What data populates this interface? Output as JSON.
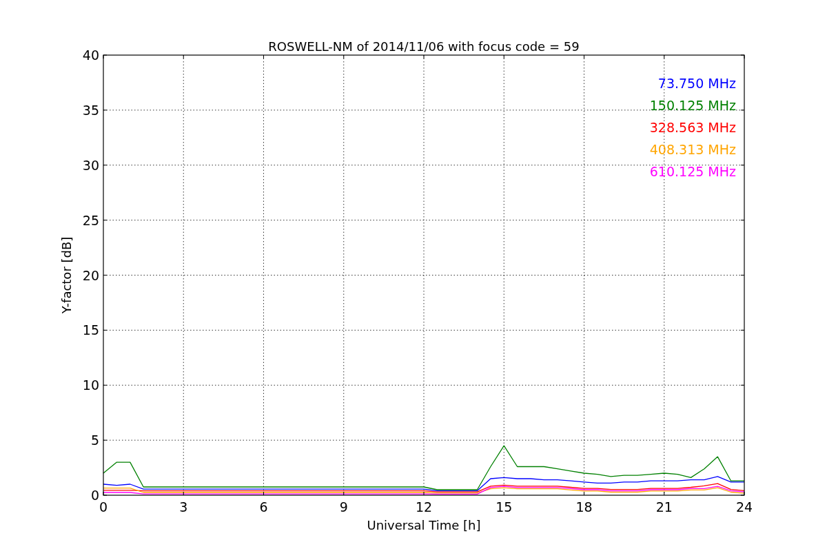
{
  "chart": {
    "chart_data": {
      "type": "line",
      "title": "ROSWELL-NM of 2014/11/06 with focus code = 59",
      "xlabel": "Universal Time [h]",
      "ylabel": "Y-factor [dB]",
      "x": [
        0,
        0.5,
        1,
        1.5,
        2,
        2.5,
        3,
        3.5,
        4,
        4.5,
        5,
        5.5,
        6,
        6.5,
        7,
        7.5,
        8,
        8.5,
        9,
        9.5,
        10,
        10.5,
        11,
        11.5,
        12,
        12.5,
        13,
        13.5,
        14,
        14.5,
        15,
        15.5,
        16,
        16.5,
        17,
        17.5,
        18,
        18.5,
        19,
        19.5,
        20,
        20.5,
        21,
        21.5,
        22,
        22.5,
        23,
        23.5,
        24
      ],
      "series": [
        {
          "name": "73.750 MHz",
          "color": "#0000ff",
          "values": [
            1.0,
            0.9,
            1.0,
            0.55,
            0.55,
            0.55,
            0.55,
            0.55,
            0.55,
            0.55,
            0.55,
            0.55,
            0.55,
            0.55,
            0.55,
            0.55,
            0.55,
            0.55,
            0.55,
            0.55,
            0.55,
            0.55,
            0.55,
            0.55,
            0.55,
            0.4,
            0.4,
            0.4,
            0.4,
            1.5,
            1.6,
            1.5,
            1.5,
            1.4,
            1.4,
            1.3,
            1.2,
            1.1,
            1.1,
            1.2,
            1.2,
            1.3,
            1.3,
            1.3,
            1.4,
            1.4,
            1.7,
            1.2,
            1.2
          ]
        },
        {
          "name": "150.125 MHz",
          "color": "#008000",
          "values": [
            2.0,
            3.0,
            3.0,
            0.75,
            0.75,
            0.75,
            0.75,
            0.75,
            0.75,
            0.75,
            0.75,
            0.75,
            0.75,
            0.75,
            0.75,
            0.75,
            0.75,
            0.75,
            0.75,
            0.75,
            0.75,
            0.75,
            0.75,
            0.75,
            0.75,
            0.5,
            0.5,
            0.5,
            0.5,
            2.6,
            4.5,
            2.6,
            2.6,
            2.6,
            2.4,
            2.2,
            2.0,
            1.9,
            1.7,
            1.8,
            1.8,
            1.9,
            2.0,
            1.9,
            1.6,
            2.4,
            3.5,
            1.3,
            1.3
          ]
        },
        {
          "name": "328.563 MHz",
          "color": "#ff0000",
          "values": [
            0.45,
            0.45,
            0.45,
            0.4,
            0.4,
            0.4,
            0.4,
            0.4,
            0.4,
            0.4,
            0.4,
            0.4,
            0.4,
            0.4,
            0.4,
            0.4,
            0.4,
            0.4,
            0.4,
            0.4,
            0.4,
            0.4,
            0.4,
            0.4,
            0.4,
            0.3,
            0.3,
            0.3,
            0.3,
            0.82,
            0.92,
            0.82,
            0.82,
            0.82,
            0.82,
            0.72,
            0.62,
            0.62,
            0.52,
            0.52,
            0.52,
            0.62,
            0.62,
            0.62,
            0.72,
            0.85,
            1.05,
            0.52,
            0.42
          ]
        },
        {
          "name": "408.313 MHz",
          "color": "#ffa500",
          "values": [
            0.65,
            0.65,
            0.65,
            0.25,
            0.25,
            0.25,
            0.25,
            0.25,
            0.25,
            0.25,
            0.25,
            0.25,
            0.25,
            0.25,
            0.25,
            0.25,
            0.25,
            0.25,
            0.25,
            0.25,
            0.25,
            0.25,
            0.25,
            0.25,
            0.25,
            0.2,
            0.2,
            0.2,
            0.2,
            0.58,
            0.68,
            0.58,
            0.58,
            0.58,
            0.58,
            0.48,
            0.38,
            0.38,
            0.28,
            0.28,
            0.28,
            0.38,
            0.38,
            0.38,
            0.48,
            0.48,
            0.68,
            0.28,
            0.18
          ]
        },
        {
          "name": "610.125 MHz",
          "color": "#ff00ff",
          "values": [
            0.25,
            0.25,
            0.25,
            0.12,
            0.12,
            0.12,
            0.12,
            0.12,
            0.12,
            0.12,
            0.12,
            0.12,
            0.12,
            0.12,
            0.12,
            0.12,
            0.12,
            0.12,
            0.12,
            0.12,
            0.12,
            0.12,
            0.12,
            0.12,
            0.12,
            0.1,
            0.1,
            0.1,
            0.1,
            0.7,
            0.8,
            0.7,
            0.7,
            0.7,
            0.7,
            0.6,
            0.5,
            0.5,
            0.4,
            0.4,
            0.4,
            0.5,
            0.5,
            0.5,
            0.6,
            0.6,
            0.8,
            0.4,
            0.3
          ]
        }
      ],
      "grid": true,
      "xlim": [
        0,
        24
      ],
      "ylim": [
        0,
        40
      ],
      "xticks": [
        0,
        3,
        6,
        9,
        12,
        15,
        18,
        21,
        24
      ],
      "yticks": [
        0,
        5,
        10,
        15,
        20,
        25,
        30,
        35,
        40
      ]
    }
  }
}
